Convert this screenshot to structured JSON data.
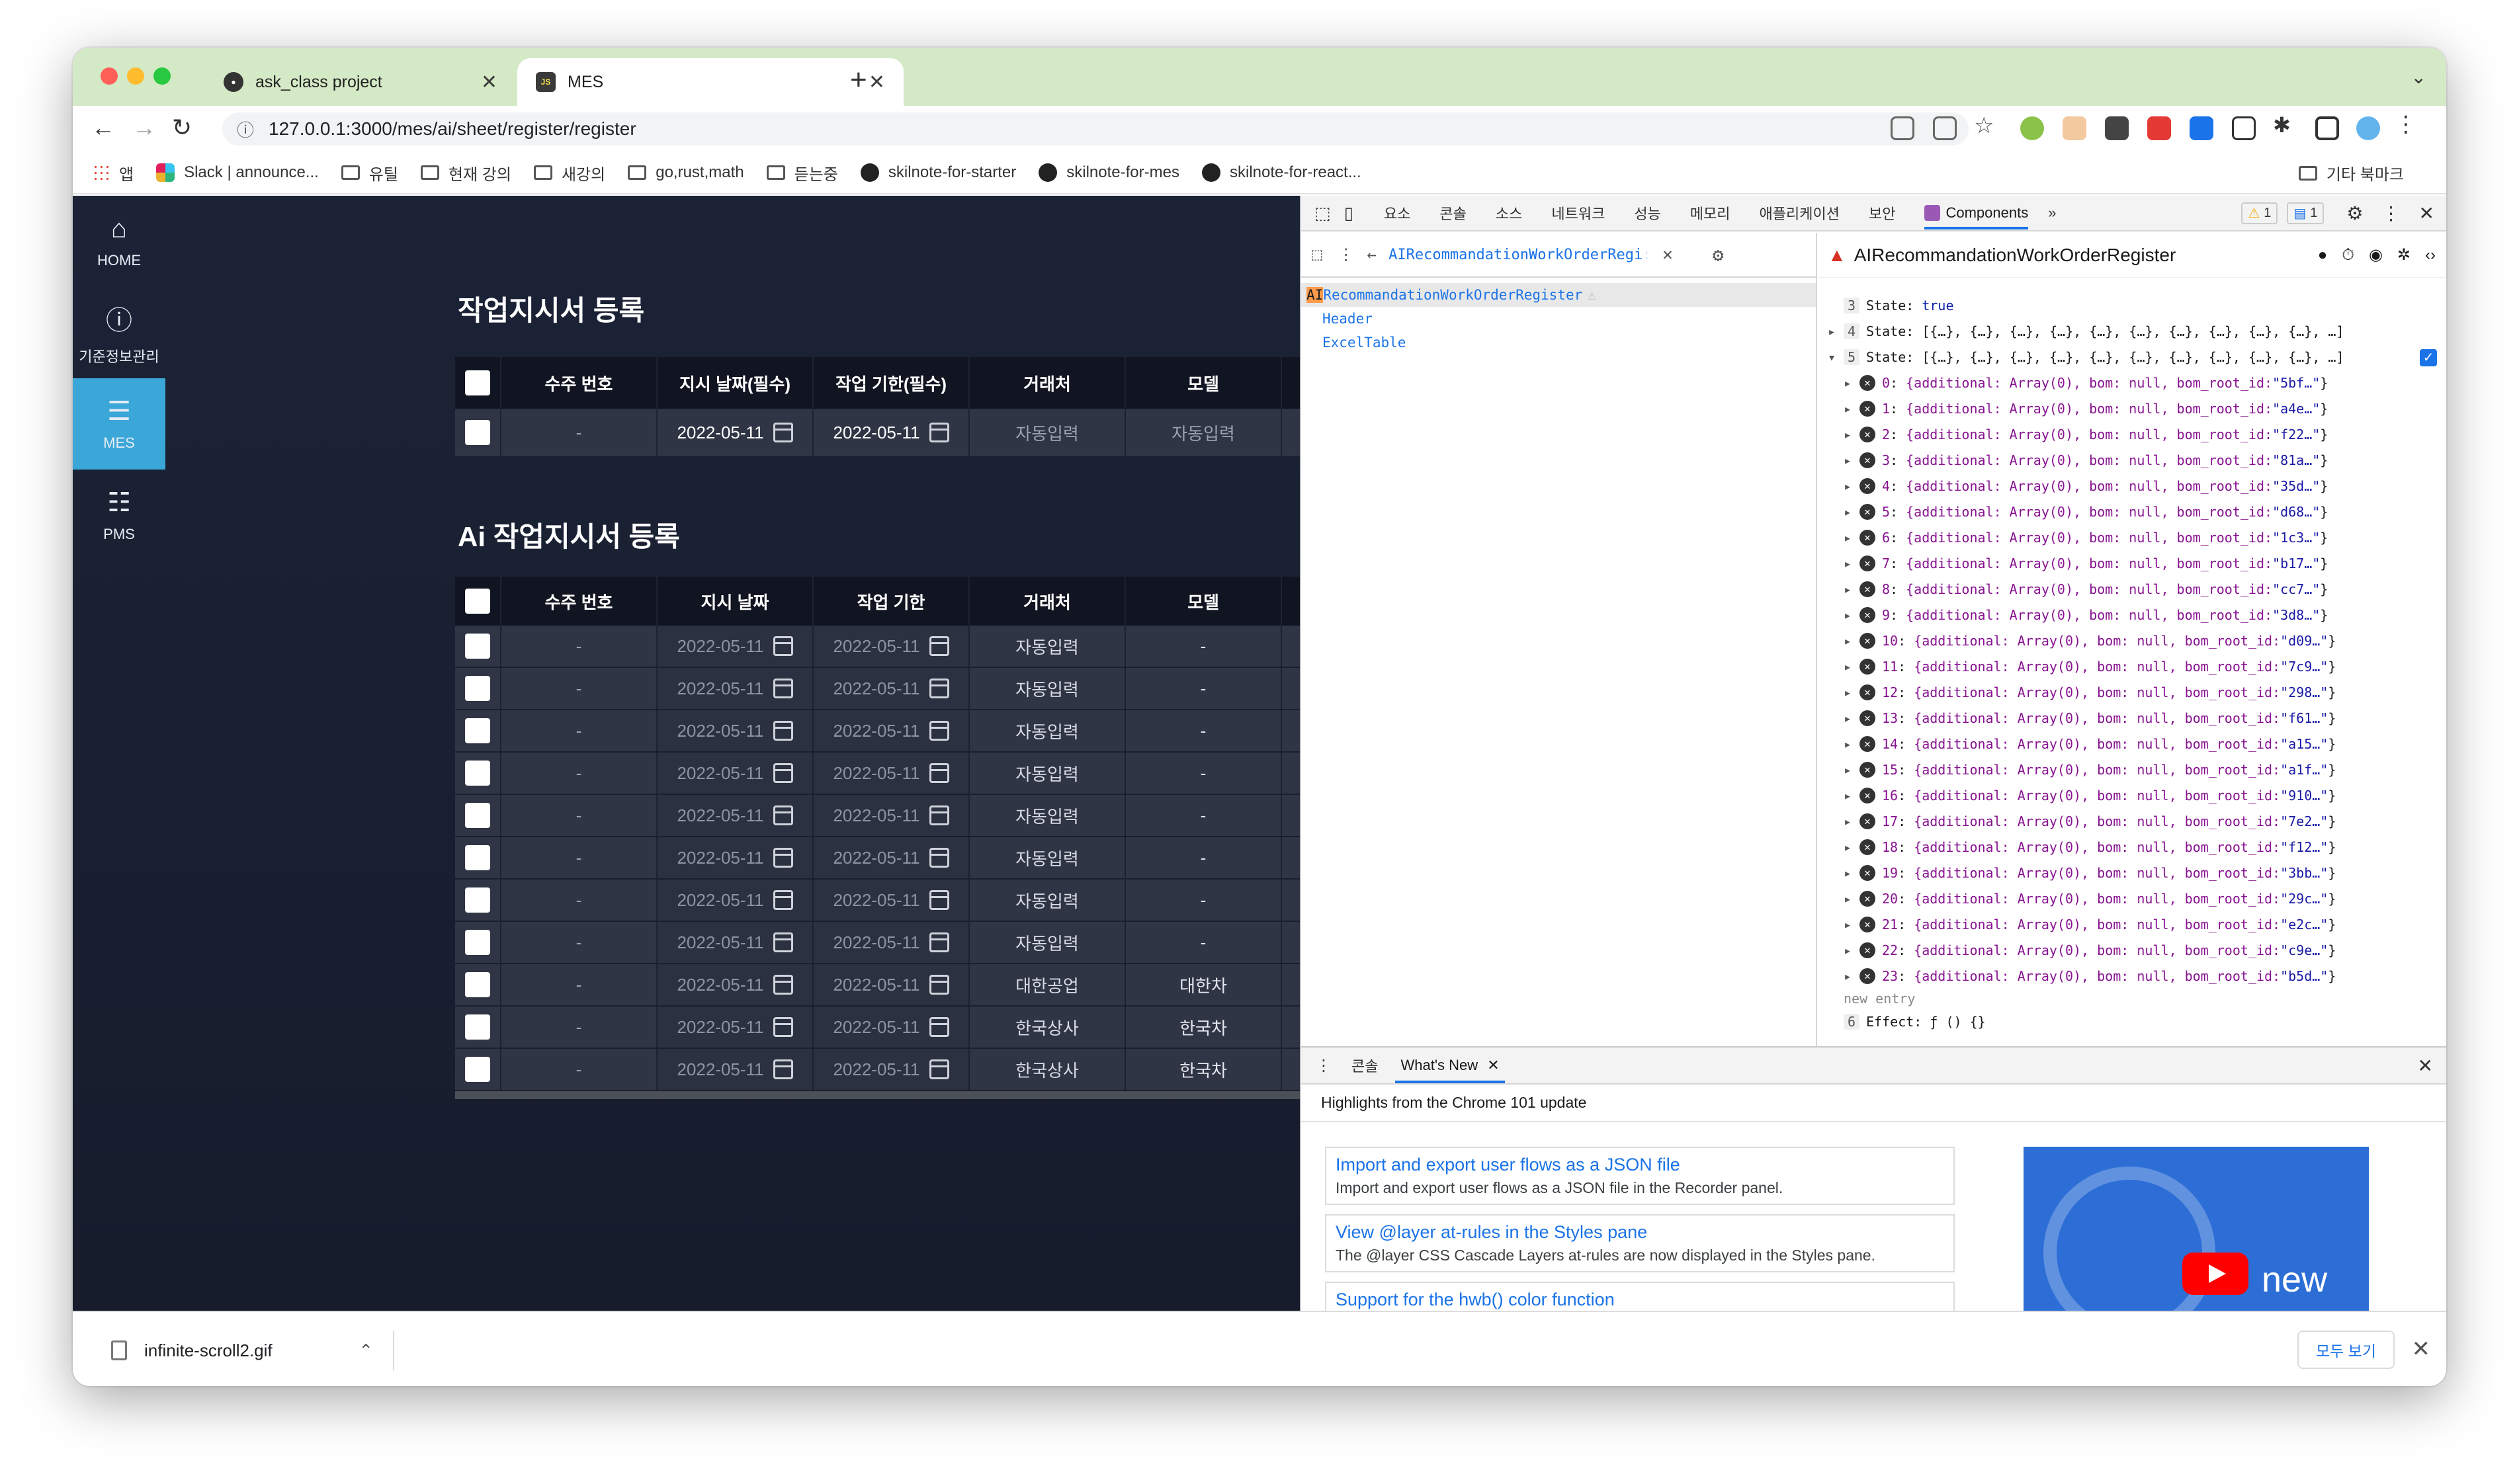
{
  "browser": {
    "tabs": [
      {
        "title": "ask_class project",
        "active": false
      },
      {
        "title": "MES",
        "active": true,
        "favicon_text": "JS"
      }
    ],
    "url": "127.0.0.1:3000/mes/ai/sheet/register/register",
    "bookmarks": [
      {
        "label": "앱",
        "icon": "apps-icon"
      },
      {
        "label": "Slack | announce...",
        "icon": "slack-icon"
      },
      {
        "label": "유틸",
        "icon": "folder-icon"
      },
      {
        "label": "현재 강의",
        "icon": "folder-icon"
      },
      {
        "label": "새강의",
        "icon": "folder-icon"
      },
      {
        "label": "go,rust,math",
        "icon": "folder-icon"
      },
      {
        "label": "듣는중",
        "icon": "folder-icon"
      },
      {
        "label": "skilnote-for-starter",
        "icon": "github-icon"
      },
      {
        "label": "skilnote-for-mes",
        "icon": "github-icon"
      },
      {
        "label": "skilnote-for-react...",
        "icon": "github-icon"
      }
    ],
    "bookmarks_other": "기타 북마크"
  },
  "sidebar": {
    "items": [
      {
        "label": "HOME",
        "icon": "home-icon",
        "active": false
      },
      {
        "label": "기준정보관리",
        "icon": "info-icon",
        "active": false
      },
      {
        "label": "MES",
        "icon": "sliders-icon",
        "active": true
      },
      {
        "label": "PMS",
        "icon": "machine-icon",
        "active": false
      }
    ]
  },
  "main": {
    "section1": {
      "title": "작업지시서 등록",
      "headers": [
        "수주 번호",
        "지시 날짜(필수)",
        "작업 기한(필수)",
        "거래처",
        "모델"
      ],
      "rows": [
        {
          "order": "-",
          "date": "2022-05-11",
          "deadline": "2022-05-11",
          "company": "자동입력",
          "model": "자동입력"
        }
      ]
    },
    "section2": {
      "title": "Ai 작업지시서 등록",
      "headers": [
        "수주 번호",
        "지시 날짜",
        "작업 기한",
        "거래처",
        "모델"
      ],
      "rows": [
        {
          "order": "-",
          "date": "2022-05-11",
          "deadline": "2022-05-11",
          "company": "자동입력",
          "model": "-"
        },
        {
          "order": "-",
          "date": "2022-05-11",
          "deadline": "2022-05-11",
          "company": "자동입력",
          "model": "-"
        },
        {
          "order": "-",
          "date": "2022-05-11",
          "deadline": "2022-05-11",
          "company": "자동입력",
          "model": "-"
        },
        {
          "order": "-",
          "date": "2022-05-11",
          "deadline": "2022-05-11",
          "company": "자동입력",
          "model": "-"
        },
        {
          "order": "-",
          "date": "2022-05-11",
          "deadline": "2022-05-11",
          "company": "자동입력",
          "model": "-"
        },
        {
          "order": "-",
          "date": "2022-05-11",
          "deadline": "2022-05-11",
          "company": "자동입력",
          "model": "-"
        },
        {
          "order": "-",
          "date": "2022-05-11",
          "deadline": "2022-05-11",
          "company": "자동입력",
          "model": "-"
        },
        {
          "order": "-",
          "date": "2022-05-11",
          "deadline": "2022-05-11",
          "company": "자동입력",
          "model": "-"
        },
        {
          "order": "-",
          "date": "2022-05-11",
          "deadline": "2022-05-11",
          "company": "대한공업",
          "model": "대한차"
        },
        {
          "order": "-",
          "date": "2022-05-11",
          "deadline": "2022-05-11",
          "company": "한국상사",
          "model": "한국차"
        },
        {
          "order": "-",
          "date": "2022-05-11",
          "deadline": "2022-05-11",
          "company": "한국상사",
          "model": "한국차"
        }
      ]
    }
  },
  "devtools": {
    "tabs": [
      "요소",
      "콘솔",
      "소스",
      "네트워크",
      "성능",
      "메모리",
      "애플리케이션",
      "보안"
    ],
    "active_tab": "Components",
    "warnings": "1",
    "messages": "1",
    "search_value": "AIRecommandationWorkOrderRegi:",
    "tree": {
      "selected": "AIRecommandationWorkOrderRegister",
      "selected_highlight": "AI",
      "selected_rest": "RecommandationWorkOrderRegister",
      "children": [
        "Header",
        "ExcelTable"
      ]
    },
    "component_name": "AIRecommandationWorkOrderRegister",
    "hooks": {
      "state3_label": "State:",
      "state3_value": "true",
      "state4": "State: [{…}, {…}, {…}, {…}, {…}, {…}, {…}, {…}, {…}, {…}, …]",
      "state5": "State: [{…}, {…}, {…}, {…}, {…}, {…}, {…}, {…}, {…}, {…}, …]",
      "entries": [
        {
          "index": "0",
          "id": "\"5bf…\""
        },
        {
          "index": "1",
          "id": "\"a4e…\""
        },
        {
          "index": "2",
          "id": "\"f22…\""
        },
        {
          "index": "3",
          "id": "\"81a…\""
        },
        {
          "index": "4",
          "id": "\"35d…\""
        },
        {
          "index": "5",
          "id": "\"d68…\""
        },
        {
          "index": "6",
          "id": "\"1c3…\""
        },
        {
          "index": "7",
          "id": "\"b17…\""
        },
        {
          "index": "8",
          "id": "\"cc7…\""
        },
        {
          "index": "9",
          "id": "\"3d8…\""
        },
        {
          "index": "10",
          "id": "\"d09…\""
        },
        {
          "index": "11",
          "id": "\"7c9…\""
        },
        {
          "index": "12",
          "id": "\"298…\""
        },
        {
          "index": "13",
          "id": "\"f61…\""
        },
        {
          "index": "14",
          "id": "\"a15…\""
        },
        {
          "index": "15",
          "id": "\"a1f…\""
        },
        {
          "index": "16",
          "id": "\"910…\""
        },
        {
          "index": "17",
          "id": "\"7e2…\""
        },
        {
          "index": "18",
          "id": "\"f12…\""
        },
        {
          "index": "19",
          "id": "\"3bb…\""
        },
        {
          "index": "20",
          "id": "\"29c…\""
        },
        {
          "index": "21",
          "id": "\"e2c…\""
        },
        {
          "index": "22",
          "id": "\"c9e…\""
        },
        {
          "index": "23",
          "id": "\"b5d…\""
        }
      ],
      "entry_text": "{additional: Array(0), bom: null, bom_root_id: ",
      "new_entry": "new entry",
      "effect": "Effect: ƒ () {}"
    },
    "drawer": {
      "tabs": [
        "콘솔",
        "What's New"
      ],
      "headline": "Highlights from the Chrome 101 update",
      "cards": [
        {
          "title": "Import and export user flows as a JSON file",
          "desc": "Import and export user flows as a JSON file in the Recorder panel."
        },
        {
          "title": "View @layer at-rules in the Styles pane",
          "desc": "The @layer CSS Cascade Layers at-rules are now displayed in the Styles pane."
        },
        {
          "title": "Support for the hwb() color function",
          "desc": ""
        }
      ],
      "video_text": "new"
    }
  },
  "downloads": {
    "file": "infinite-scroll2.gif",
    "show_all": "모두 보기"
  }
}
